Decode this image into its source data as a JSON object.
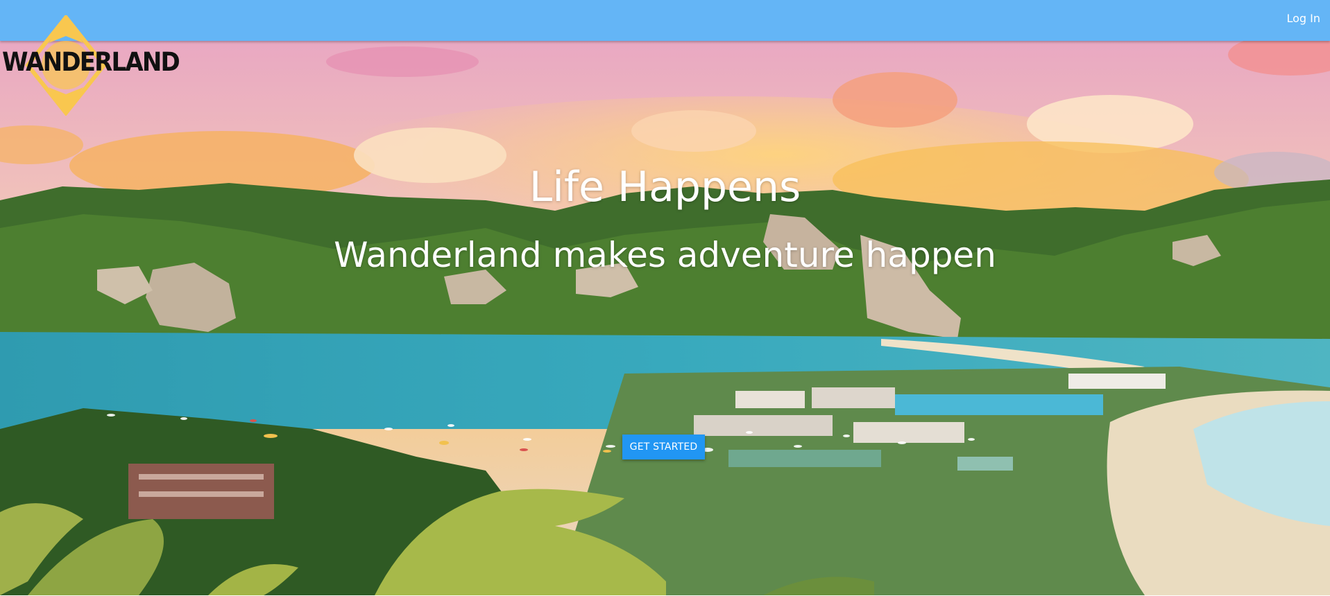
{
  "header": {
    "login_label": "Log In"
  },
  "logo": {
    "text": "WANDERLAND"
  },
  "hero": {
    "title": "Life Happens",
    "subtitle": "Wanderland makes adventure happen",
    "cta_label": "GET STARTED"
  },
  "colors": {
    "header_bg": "#64b5f6",
    "cta_bg": "#2196f3",
    "logo_accent": "#f9c74f",
    "text": "#ffffff"
  }
}
